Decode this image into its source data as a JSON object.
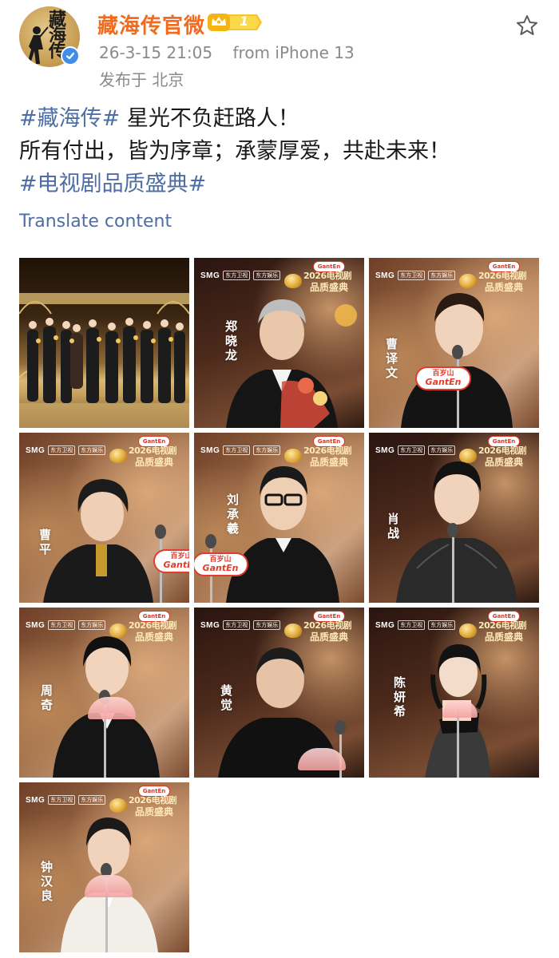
{
  "account": {
    "name": "藏海传官微",
    "avatar_text": "藏海传",
    "vip_level": "1",
    "verified": true
  },
  "meta": {
    "time": "26-3-15 21:05",
    "source": "from iPhone 13",
    "location": "发布于 北京"
  },
  "post": {
    "hashtag_1": "#藏海传#",
    "line_1_text": " 星光不负赶路人！",
    "line_2_text": "所有付出，皆为序章；承蒙厚爱，共赴未来！",
    "hashtag_2": "#电视剧品质盛典#",
    "translate_label": "Translate content"
  },
  "event": {
    "broadcaster": "SMG",
    "channel_1": "东方卫视",
    "channel_2": "东方娱乐",
    "title_top": "2026电视剧",
    "title_bottom": "品质盛典",
    "sponsor_cn": "百岁山",
    "sponsor_en": "GantEn"
  },
  "images": [
    {
      "caption": ""
    },
    {
      "caption": "郑晓龙"
    },
    {
      "caption": "曹译文"
    },
    {
      "caption": "曹平"
    },
    {
      "caption": "刘承羲"
    },
    {
      "caption": "肖战"
    },
    {
      "caption": "周奇"
    },
    {
      "caption": "黄觉"
    },
    {
      "caption": "陈妍希"
    },
    {
      "caption": "钟汉良"
    }
  ],
  "colors": {
    "username": "#f26b1d",
    "hashtag": "#4e6ea3",
    "meta": "#8a8a8a",
    "verified": "#3f8ee8",
    "vip": "#f5b40f"
  },
  "icons": {
    "verified": "verified-check-icon",
    "vip": "vip-crown-icon",
    "favorite": "star-outline-icon"
  }
}
